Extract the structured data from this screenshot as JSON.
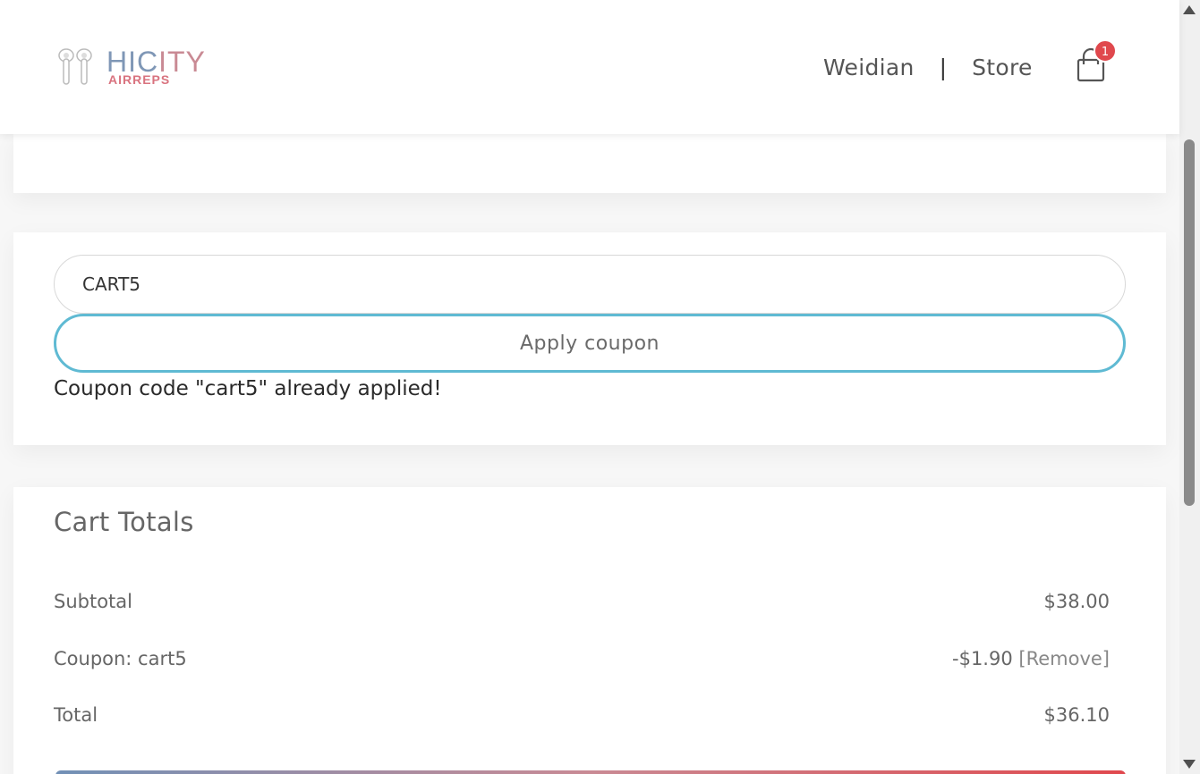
{
  "header": {
    "logo": {
      "brand": "HICITY",
      "sub": "AIRREPS"
    },
    "nav": [
      {
        "label": "Weidian"
      },
      {
        "label": "Store"
      }
    ],
    "nav_separator": "|",
    "cart": {
      "count": "1"
    }
  },
  "coupon": {
    "input_value": "CART5",
    "apply_label": "Apply coupon",
    "message": "Coupon code \"cart5\" already applied!"
  },
  "totals": {
    "title": "Cart Totals",
    "subtotal_label": "Subtotal",
    "subtotal_value": "$38.00",
    "coupon_label": "Coupon: cart5",
    "coupon_value": "-$1.90",
    "coupon_remove": "[Remove]",
    "total_label": "Total",
    "total_value": "$36.10"
  },
  "colors": {
    "accent": "#5fbad3",
    "badge": "#e0484d",
    "logo_blue": "#7f97b6",
    "logo_pink": "#d9737f"
  },
  "icons": [
    "earbuds-logo-icon",
    "shopping-bag-icon",
    "scroll-up-icon",
    "scroll-down-icon"
  ]
}
